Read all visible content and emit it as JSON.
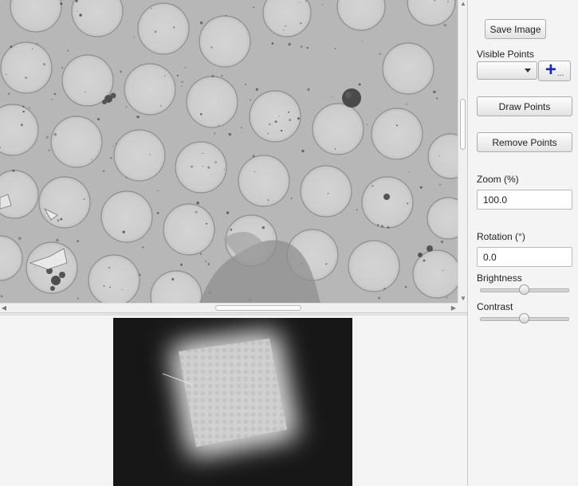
{
  "controls": {
    "save_image_label": "Save Image",
    "visible_points_label": "Visible Points",
    "visible_points_value": "",
    "add_points_dots": "...",
    "draw_points_label": "Draw Points",
    "remove_points_label": "Remove Points",
    "zoom_label": "Zoom (%)",
    "zoom_value": "100.0",
    "rotation_label": "Rotation (°)",
    "rotation_value": "0.0",
    "brightness_label": "Brightness",
    "brightness_level": 0.5,
    "contrast_label": "Contrast",
    "contrast_level": 0.5
  },
  "icons": {
    "add_points": "plus-icon",
    "dropdown": "chevron-down-icon",
    "scroll_up": "arrow-up-icon",
    "scroll_down": "arrow-down-icon",
    "scroll_left": "arrow-left-icon",
    "scroll_right": "arrow-right-icon"
  },
  "colors": {
    "accent_plus": "#1126c9",
    "micrograph_background": "#b4b4b4",
    "overview_background": "#161616"
  }
}
